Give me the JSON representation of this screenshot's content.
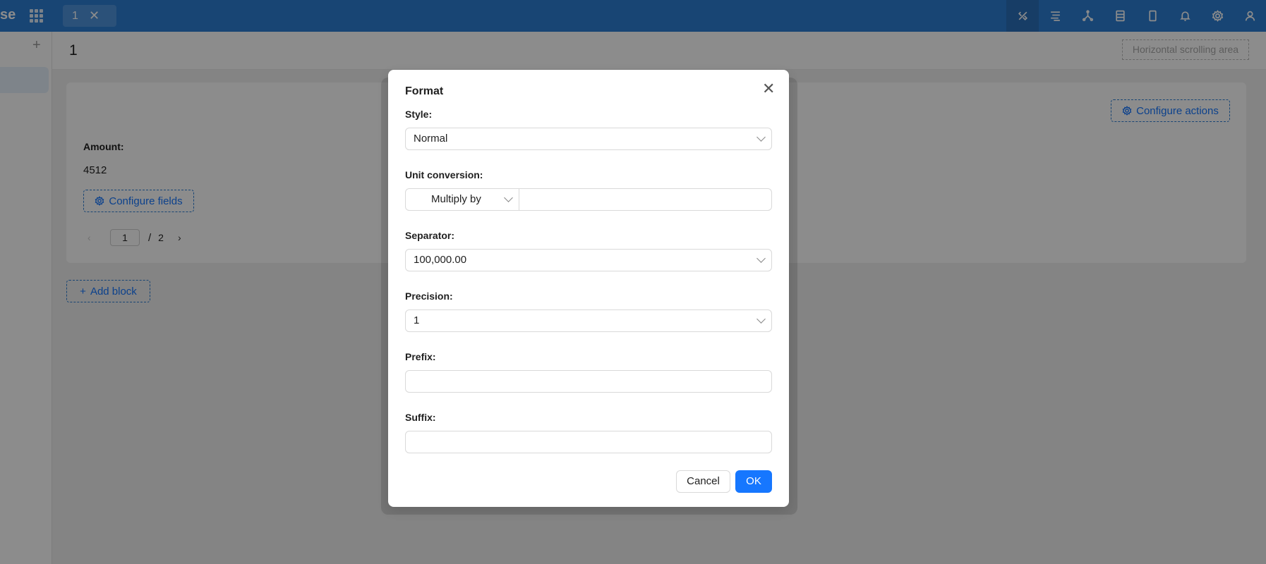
{
  "topbar": {
    "brand": "se",
    "tab_label": "1",
    "icons": [
      "design-icon",
      "workflow-icon",
      "graph-icon",
      "table-icon",
      "mobile-icon",
      "bell-icon",
      "gear-icon",
      "user-icon"
    ]
  },
  "page": {
    "title": "1",
    "hscroll_label": "Horizontal scrolling area"
  },
  "card": {
    "configure_actions_label": "Configure actions",
    "field_label": "Amount",
    "field_value": "4512",
    "configure_fields_label": "Configure fields",
    "pager": {
      "current": "1",
      "separator": "/",
      "total": "2"
    }
  },
  "add_block_label": "Add block",
  "modal": {
    "title": "Format",
    "fields": {
      "style_label": "Style",
      "style_value": "Normal",
      "unit_label": "Unit conversion",
      "unit_op": "Multiply by",
      "unit_value": "",
      "separator_label": "Separator",
      "separator_value": "100,000.00",
      "precision_label": "Precision",
      "precision_value": "1",
      "prefix_label": "Prefix",
      "prefix_value": "",
      "suffix_label": "Suffix",
      "suffix_value": ""
    },
    "cancel_label": "Cancel",
    "ok_label": "OK"
  },
  "colors": {
    "topbar": "#2d7ed4",
    "primary": "#1677ff"
  }
}
